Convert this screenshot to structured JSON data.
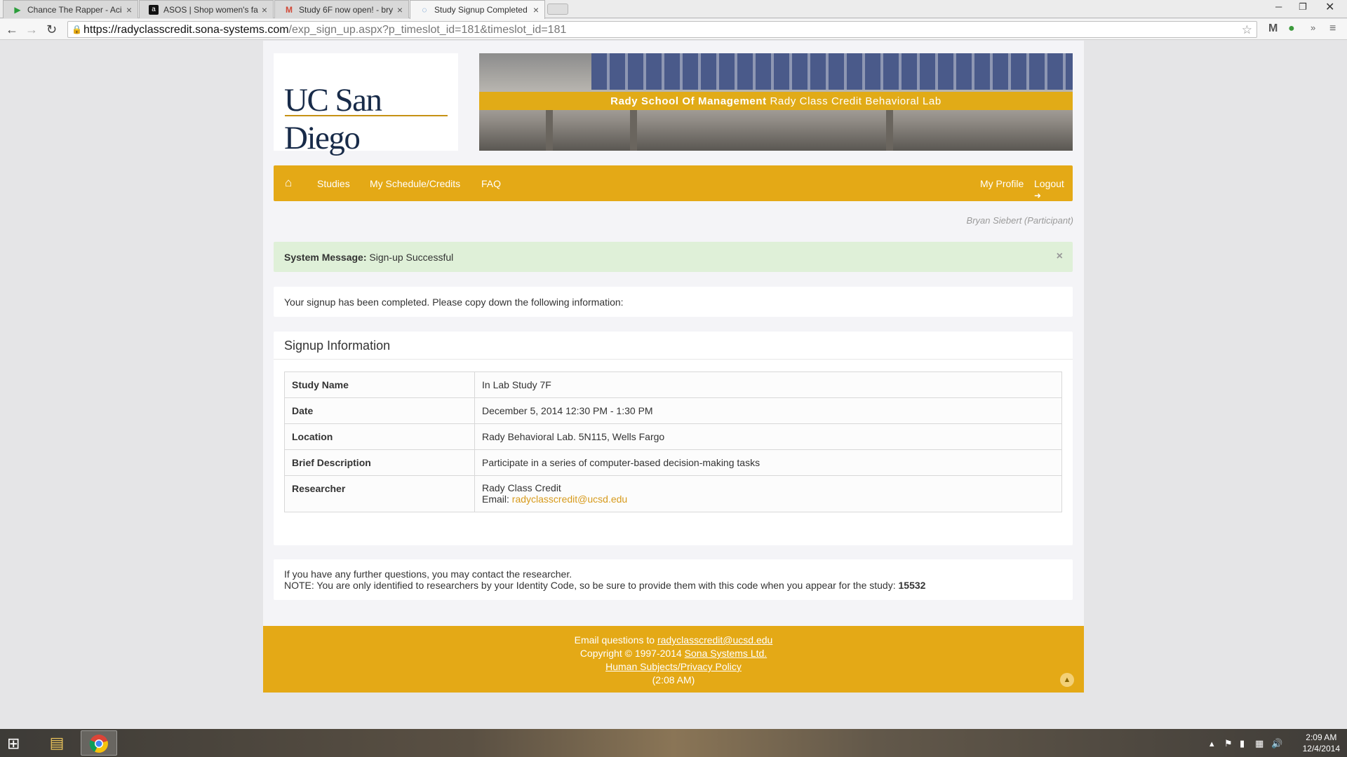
{
  "browser": {
    "tabs": [
      {
        "title": "Chance The Rapper - Aci",
        "favicon": "play-store-icon"
      },
      {
        "title": "ASOS | Shop women's fa",
        "favicon": "asos-icon"
      },
      {
        "title": "Study 6F now open! - bry",
        "favicon": "gmail-icon"
      },
      {
        "title": "Study Signup Completed",
        "favicon": "sona-icon"
      }
    ],
    "url_host": "https://radyclasscredit.sona-systems.com",
    "url_path": "/exp_sign_up.aspx?p_timeslot_id=181&timeslot_id=181"
  },
  "header": {
    "logo_text": "UC San Diego",
    "banner_bold": "Rady School Of Management",
    "banner_rest": "Rady Class Credit Behavioral Lab"
  },
  "nav": {
    "items": [
      "Studies",
      "My Schedule/Credits",
      "FAQ"
    ],
    "profile": "My Profile",
    "logout": "Logout"
  },
  "user_label": "Bryan Siebert (Participant)",
  "alert": {
    "label": "System Message:",
    "text": "Sign-up Successful"
  },
  "intro": "Your signup has been completed. Please copy down the following information:",
  "signup": {
    "title": "Signup Information",
    "rows": [
      {
        "key": "Study Name",
        "value": "In Lab Study 7F"
      },
      {
        "key": "Date",
        "value": "December 5, 2014 12:30 PM - 1:30 PM"
      },
      {
        "key": "Location",
        "value": "Rady Behavioral Lab. 5N115, Wells Fargo"
      },
      {
        "key": "Brief Description",
        "value": "Participate in a series of computer-based decision-making tasks"
      }
    ],
    "researcher_key": "Researcher",
    "researcher_name": "Rady Class Credit",
    "email_label": "Email:",
    "email": "radyclasscredit@ucsd.edu"
  },
  "notes": {
    "line1": "If you have any further questions, you may contact the researcher.",
    "line2": "NOTE: You are only identified to researchers by your Identity Code, so be sure to provide them with this code when you appear for the study:",
    "code": "15532"
  },
  "footer": {
    "email_prefix": "Email questions to",
    "email": "radyclasscredit@ucsd.edu",
    "copyright_prefix": "Copyright © 1997-2014",
    "company": "Sona Systems Ltd.",
    "policy": "Human Subjects/Privacy Policy",
    "time": "(2:08 AM)"
  },
  "taskbar": {
    "time": "2:09 AM",
    "date": "12/4/2014"
  },
  "colors": {
    "accent": "#e4a916",
    "alert_bg": "#dff0d8",
    "link": "#d79a1b",
    "ucsd_navy": "#182b49"
  }
}
